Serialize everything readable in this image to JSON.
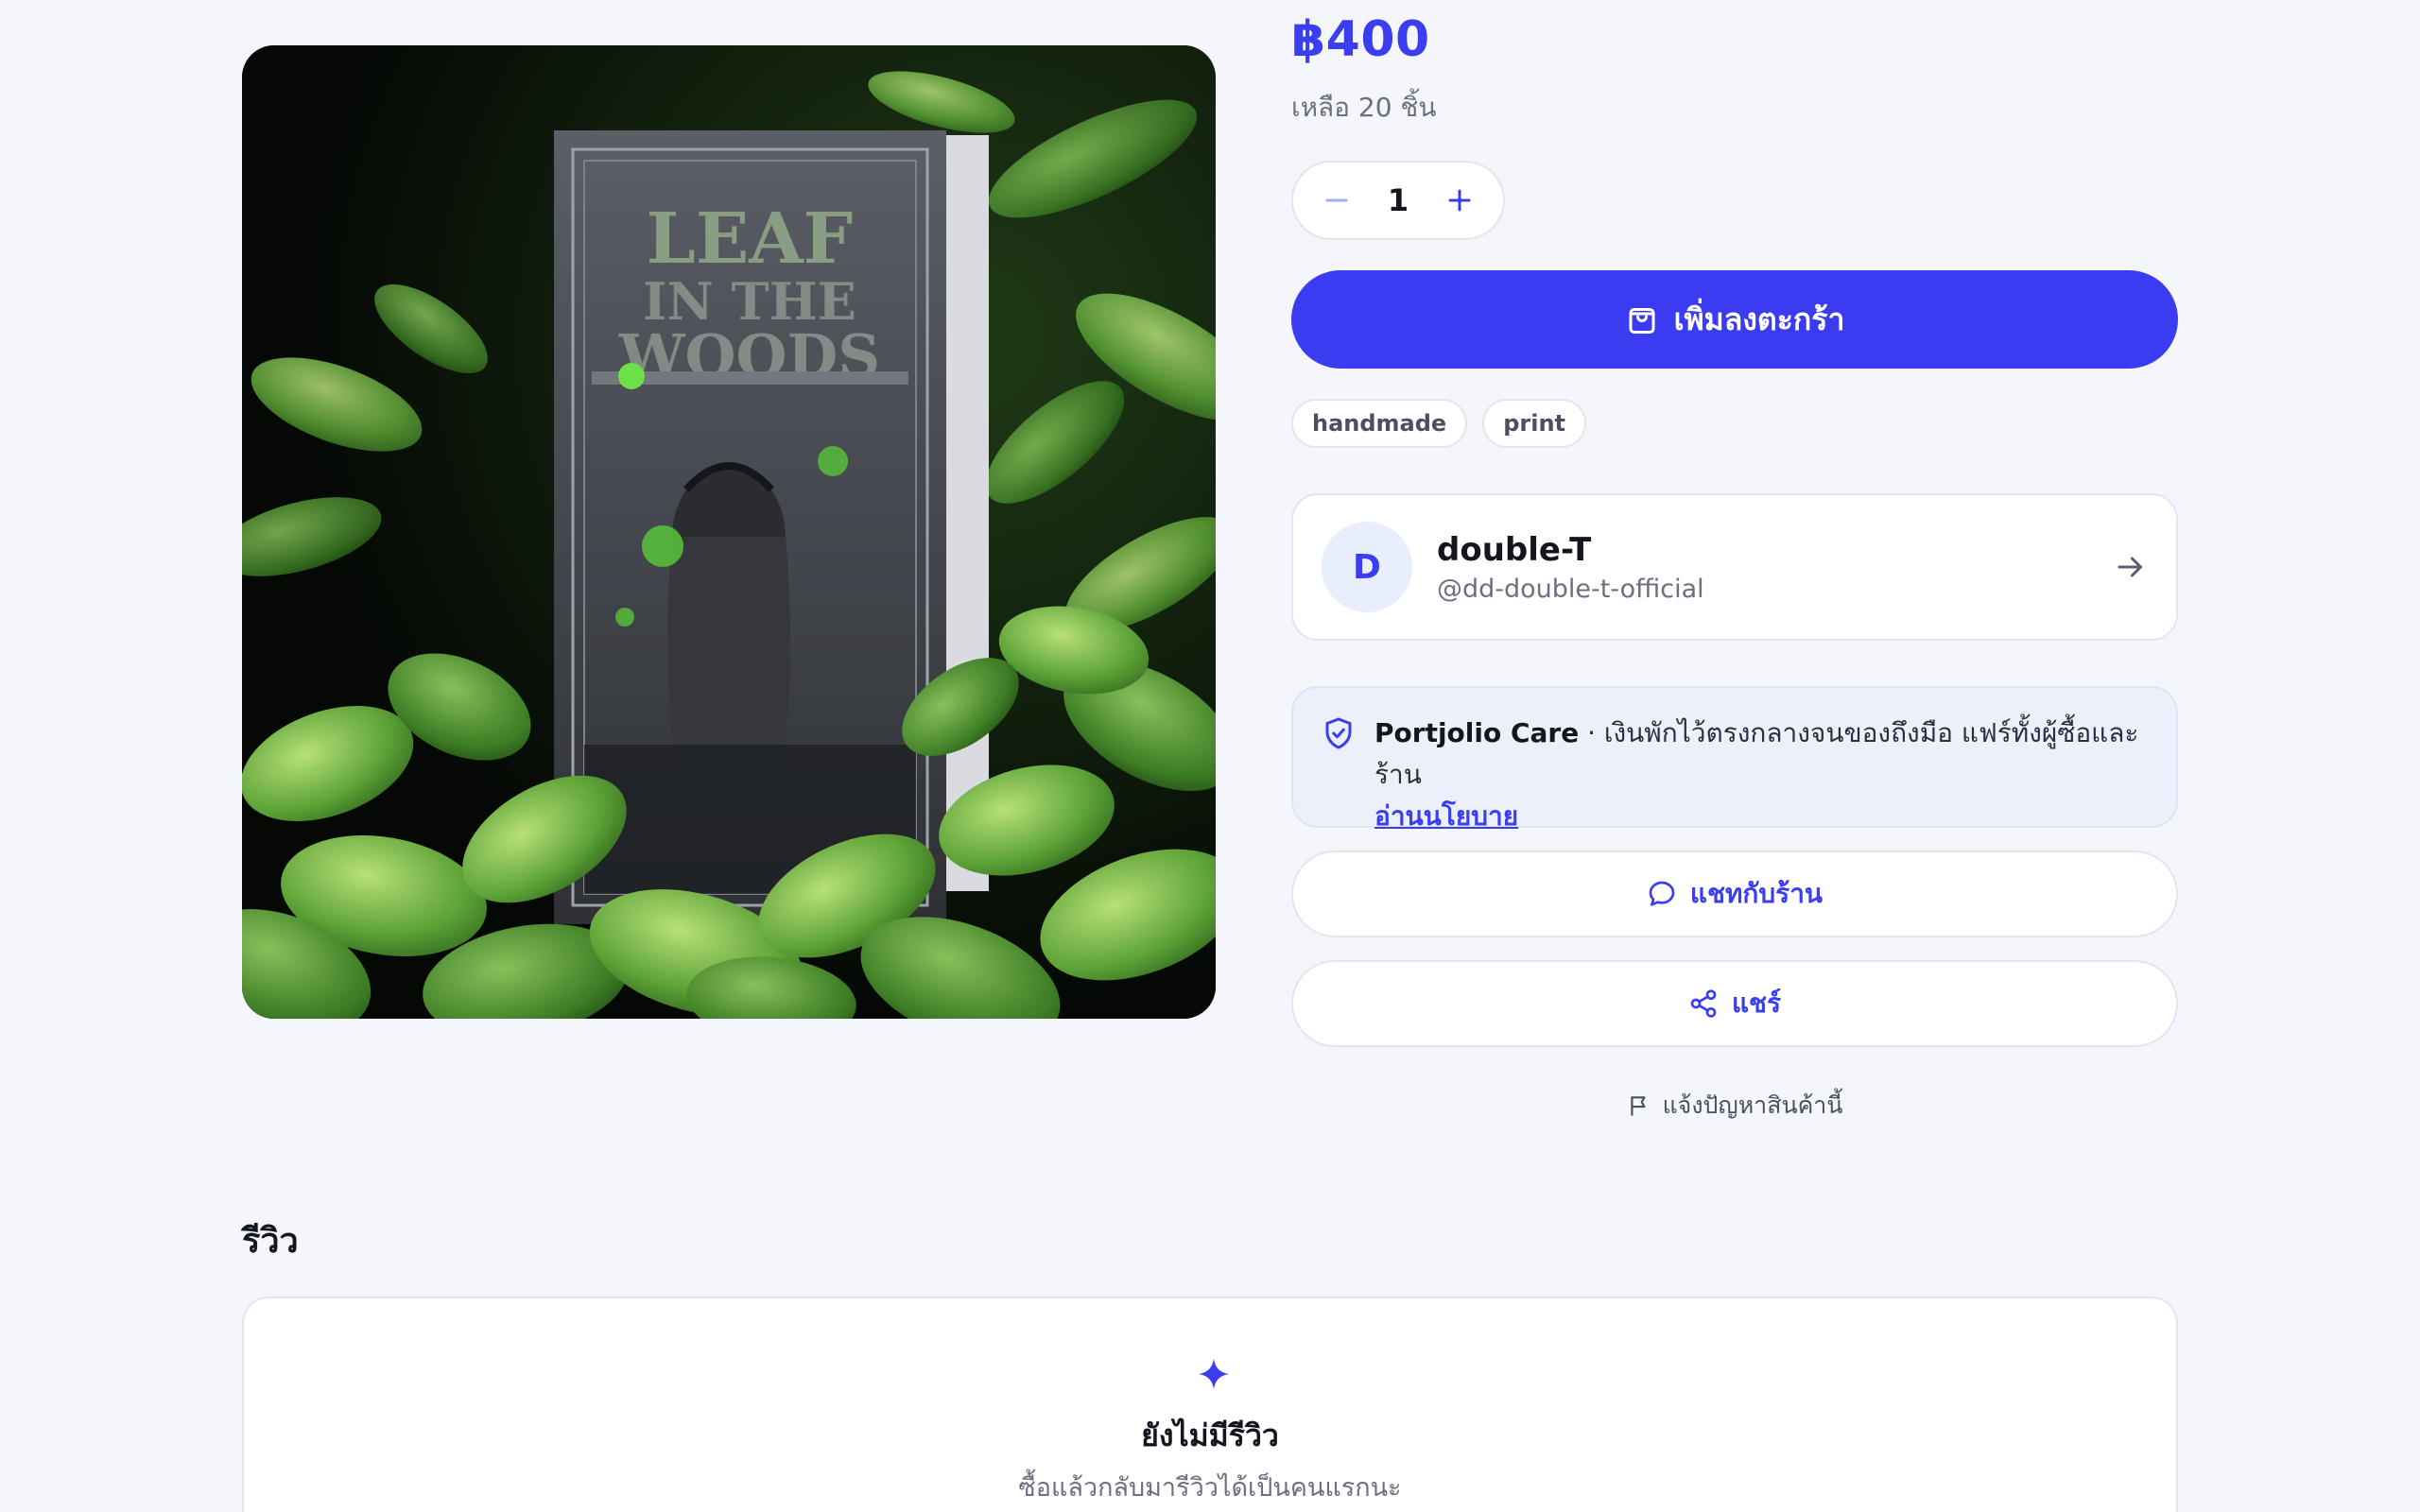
{
  "product": {
    "price": "฿400",
    "stock_text": "เหลือ 20 ชิ้น",
    "quantity": "1",
    "add_to_cart_label": "เพิ่มลงตะกร้า",
    "tags": [
      "handmade",
      "print"
    ],
    "image": {
      "cover_title_line1": "LEAF",
      "cover_title_line2": "IN THE",
      "cover_title_line3": "WOODS"
    }
  },
  "seller": {
    "avatar_initial": "D",
    "name": "double-T",
    "handle": "@dd-double-t-official"
  },
  "care": {
    "title": "Portjolio Care",
    "description": " · เงินพักไว้ตรงกลางจนของถึงมือ แฟร์ทั้งผู้ซื้อและร้าน",
    "link_label": "อ่านนโยบาย"
  },
  "actions": {
    "chat_label": "แชทกับร้าน",
    "share_label": "แชร์",
    "report_label": "แจ้งปัญหาสินค้านี้"
  },
  "reviews": {
    "heading": "รีวิว",
    "empty_title": "ยังไม่มีรีวิว",
    "empty_subtitle": "ซื้อแล้วกลับมารีวิวได้เป็นคนแรกนะ"
  },
  "colors": {
    "accent": "#3b3ef0",
    "background": "#f4f6fb",
    "care_background": "#ebf0fb"
  },
  "icons": {
    "cart": "shopping-bag-icon",
    "seller_arrow": "arrow-right-icon",
    "care": "shield-check-icon",
    "chat": "chat-bubble-icon",
    "share": "share-icon",
    "report": "flag-icon",
    "reviews_empty": "sparkle-icon"
  }
}
